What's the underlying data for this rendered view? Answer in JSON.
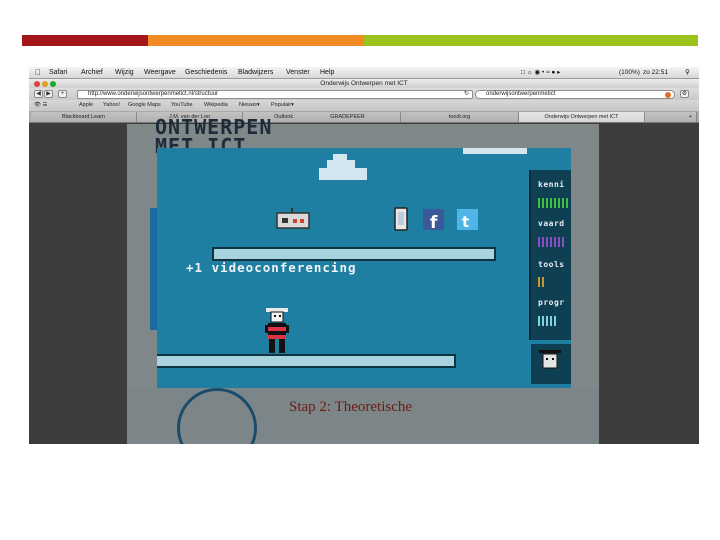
{
  "browser": {
    "menubar": {
      "apple": "",
      "items": [
        "Safari",
        "Archief",
        "Wijzig",
        "Weergave",
        "Geschiedenis",
        "Bladwijzers",
        "Venster",
        "Help"
      ],
      "battery": "(100%)",
      "clock": "zo 22:51"
    },
    "window_title": "Onderwijs Ontwerpen met ICT",
    "url": "http://www.onderwijsontwerpenmetict.nl/structuur",
    "search": "onderwijsontwerpenmetict",
    "bookmarks": [
      "Apple",
      "Yahoo!",
      "Google Maps",
      "YouTube",
      "Wikipedia",
      "Nieuws▾",
      "Populair▾"
    ],
    "tabs": [
      "Blackboard Learn",
      "J.M. van der Loo",
      "Outlook Web App",
      "GRADEPEER",
      "toodi.org",
      "Onderwijs Ontwerpen met ICT"
    ],
    "active_tab": 5,
    "new_tab": "+"
  },
  "page": {
    "header": "ONTWERPEN\nMET ICT",
    "lower_title": "Stap 2: Theoretische",
    "close": "×"
  },
  "game": {
    "score_text": "+1 videoconferencing",
    "sidebar": [
      {
        "label": "kenni",
        "color": "#3fbf3f"
      },
      {
        "label": "vaard",
        "color": "#8a4fc7"
      },
      {
        "label": "tools",
        "color": "#c79a2f"
      },
      {
        "label": "progr",
        "color": "#7fd2e0"
      }
    ]
  },
  "dock": {
    "count": 23
  },
  "slide": {
    "bands": [
      "#a4161a",
      "#ef8a24",
      "#9cc31d"
    ]
  }
}
